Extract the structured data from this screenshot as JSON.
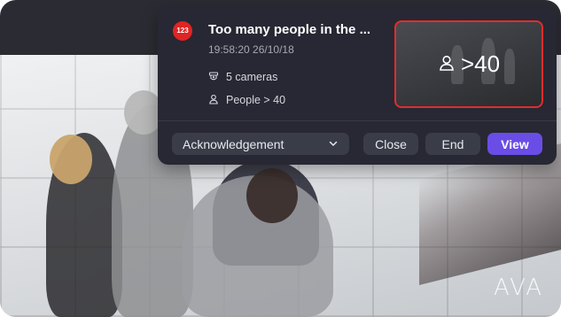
{
  "alert": {
    "badge": "123",
    "title": "Too many people in the ...",
    "timestamp": "19:58:20 26/10/18",
    "cameras": "5 cameras",
    "condition": "People > 40",
    "thumbnail_count": ">40"
  },
  "actions": {
    "status_dropdown": "Acknowledgement",
    "close": "Close",
    "end": "End",
    "view": "View"
  },
  "watermark": "AVA",
  "colors": {
    "card_bg": "#272833",
    "badge_red": "#e02424",
    "thumb_border": "#e02d2d",
    "primary": "#6a4de6",
    "button_bg": "#3a3c48"
  },
  "icons": {
    "camera": "camera-icon",
    "person": "person-icon",
    "chevron": "chevron-down-icon"
  }
}
